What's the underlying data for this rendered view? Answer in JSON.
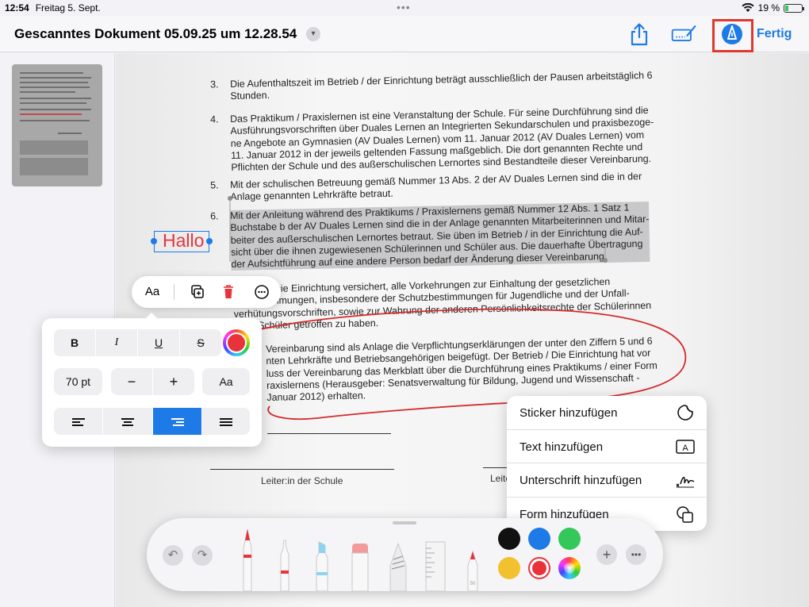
{
  "status_bar": {
    "time": "12:54",
    "date": "Freitag 5. Sept.",
    "battery": "19 %",
    "battery_level": 0.19
  },
  "nav": {
    "title": "Gescanntes Dokument 05.09.25 um 12.28.54",
    "done_label": "Fertig"
  },
  "document": {
    "paragraphs": [
      {
        "num": "3.",
        "lines": [
          "Die Aufenthaltszeit im Betrieb / der Einrichtung beträgt ausschließlich der Pausen arbeitstäglich 6",
          "Stunden."
        ]
      },
      {
        "num": "4.",
        "lines": [
          "Das Praktikum / Praxislernen ist eine Veranstaltung der Schule. Für seine Durchführung sind die",
          "Ausführungsvorschriften über Duales Lernen an Integrierten Sekundarschulen und praxisbezoge-",
          "ne Angebote an Gymnasien (AV Duales Lernen) vom 11. Januar 2012 (AV Duales Lernen) vom",
          "11. Januar 2012 in der jeweils geltenden Fassung maßgeblich. Die dort genannten Rechte und",
          "Pflichten der Schule und des außerschulischen Lernortes sind Bestandteile dieser Vereinbarung."
        ]
      },
      {
        "num": "5.",
        "lines": [
          "Mit der schulischen Betreuung gemäß Nummer 13 Abs. 2 der AV Duales Lernen sind die in der",
          "Anlage genannten Lehrkräfte betraut."
        ]
      },
      {
        "num": "6.",
        "lines": [
          "Mit der Anleitung während des Praktikums / Praxislernens gemäß Nummer 12 Abs. 1 Satz 1",
          "Buchstabe b der AV Duales Lernen sind die in der Anlage genannten Mitarbeiterinnen und Mitar-",
          "beiter des außerschulischen Lernortes betraut. Sie üben im Betrieb / in der Einrichtung die Auf-",
          "sicht über die ihnen zugewiesenen Schülerinnen und Schüler aus. Die dauerhafte Übertragung",
          "der Aufsichtführung auf eine andere Person bedarf der Änderung dieser Vereinbarung."
        ]
      },
      {
        "num": "",
        "lines": [
          "/ Die Einrichtung versichert, alle Vorkehrungen zur Einhaltung der gesetzlichen",
          "immungen, insbesondere der Schutzbestimmungen für Jugendliche und der Unfall-",
          "verhütungsvorschriften, sowie zur Wahrung der anderen Persönlichkeitsrechte der Schülerinnen",
          "Schüler getroffen zu haben."
        ]
      },
      {
        "num": "",
        "lines": [
          "Vereinbarung sind als Anlage die Verpflichtungserklärungen der unter den Ziffern 5 und 6",
          "nten Lehrkräfte und Betriebsangehörigen beigefügt. Der Betrieb / Die Einrichtung hat vor",
          "luss der Vereinbarung das Merkblatt über die Durchführung eines Praktikums / einer Form",
          "raxislernens (Herausgeber: Senatsverwaltung für Bildung, Jugend und Wissenschaft -",
          "Januar 2012) erhalten."
        ]
      }
    ],
    "signature_label_school": "Leiter:in der Schule",
    "signature_label_right": "Leite"
  },
  "annotation": {
    "text": "Hallo",
    "color": "#e8333b"
  },
  "format_toolbar": {
    "font_label": "Aa"
  },
  "font_popover": {
    "bold": "B",
    "italic": "I",
    "underline": "U",
    "strike": "S",
    "size": "70 pt",
    "minus": "−",
    "plus": "+",
    "font_button": "Aa",
    "text_color": "#e8333b",
    "active_alignment": "right"
  },
  "add_menu": {
    "items": [
      {
        "label": "Sticker hinzufügen",
        "icon": "sticker-icon"
      },
      {
        "label": "Text hinzufügen",
        "icon": "text-box-icon"
      },
      {
        "label": "Unterschrift hinzufügen",
        "icon": "signature-icon"
      },
      {
        "label": "Form hinzufügen",
        "icon": "shapes-icon"
      }
    ]
  },
  "palette": {
    "tools": [
      "pen",
      "fineliner",
      "highlighter",
      "eraser",
      "lasso",
      "ruler",
      "fountain-pen"
    ],
    "colors": [
      "#111111",
      "#1e7ae6",
      "#34c759",
      "#f2c12e",
      "#e8333b",
      "color-wheel"
    ],
    "selected_color": "#e8333b",
    "ruler_label": "50"
  },
  "colors": {
    "accent": "#1e7ae6",
    "highlight_frame": "#e0382d"
  }
}
